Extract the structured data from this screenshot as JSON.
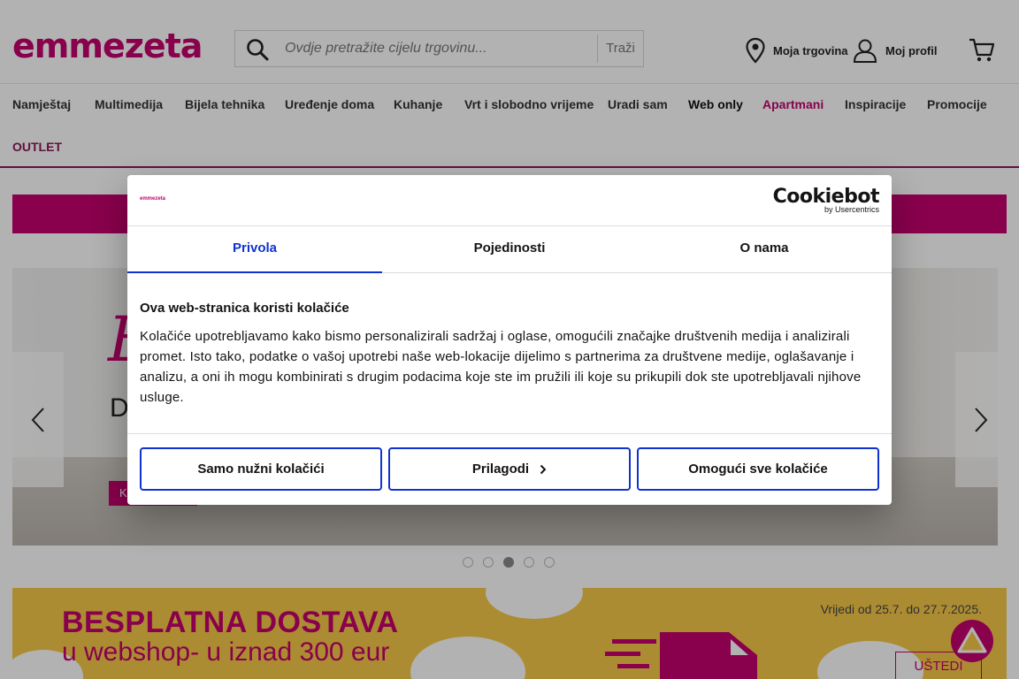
{
  "header": {
    "logo_text": "emmezeta",
    "logo_color": "#c4006e",
    "search": {
      "placeholder": "Ovdje pretražite cijelu trgovinu...",
      "button_label": "Traži",
      "icon": "search-icon"
    },
    "store_label": "Moja trgovina",
    "store_icon": "location-pin-icon",
    "profile_label": "Moj profil",
    "profile_icon": "user-icon",
    "cart_icon": "cart-icon"
  },
  "nav": {
    "items": [
      {
        "label": "Namještaj"
      },
      {
        "label": "Multimedija"
      },
      {
        "label": "Bijela tehnika"
      },
      {
        "label": "Uređenje doma"
      },
      {
        "label": "Kuhanje"
      },
      {
        "label": "Vrt i slobodno vrijeme"
      },
      {
        "label": "Uradi sam"
      },
      {
        "label": "Web only"
      },
      {
        "label": "Apartmani"
      },
      {
        "label": "Inspiracije"
      },
      {
        "label": "Promocije"
      },
      {
        "label": "OUTLET"
      }
    ],
    "accent_color": "#c4006e",
    "highlight_color": "#8a1a5a"
  },
  "slider": {
    "big_letter": "E",
    "text_fragment": "D",
    "button_fragment": "K",
    "prev_icon": "chevron-left-icon",
    "next_icon": "chevron-right-icon",
    "slide_count": 5,
    "active_slide": 3
  },
  "promo": {
    "title": "BESPLATNA DOSTAVA",
    "subtitle": "u webshop- u iznad 300 eur",
    "date": "Vrijedi od 25.7. do 27.7.2025.",
    "button_label": "UŠTEDI",
    "background_color": "#f7c948",
    "truck_icon": "delivery-truck-icon"
  },
  "scroll_top_icon": "arrow-up-icon",
  "cookie_dialog": {
    "brand_mini": "emmezeta",
    "provider_name": "Cookiebot",
    "provider_sub": "by Usercentrics",
    "tabs": [
      {
        "label": "Privola"
      },
      {
        "label": "Pojedinosti"
      },
      {
        "label": "O nama"
      }
    ],
    "active_tab": 0,
    "title": "Ova web-stranica koristi kolačiće",
    "body": "Kolačiće upotrebljavamo kako bismo personalizirali sadržaj i oglase, omogućili značajke društvenih medija i analizirali promet. Isto tako, podatke o vašoj upotrebi naše web-lokacije dijelimo s partnerima za društvene medije, oglašavanje i analizu, a oni ih mogu kombinirati s drugim podacima koje ste im pružili ili koje su prikupili dok ste upotrebljavali njihove usluge.",
    "buttons": {
      "necessary": "Samo nužni kolačići",
      "customize": "Prilagodi",
      "allow_all": "Omogući sve kolačiće"
    },
    "accent_color": "#1032cf"
  }
}
